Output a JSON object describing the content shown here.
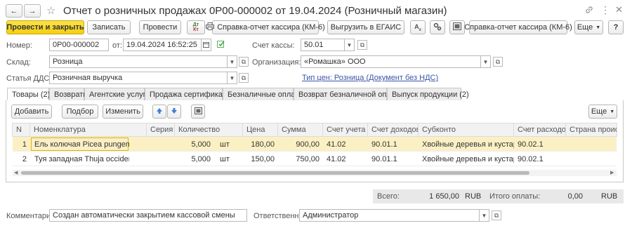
{
  "window": {
    "title": "Отчет о розничных продажах 0Р00-000002 от 19.04.2024 (Розничный магазин)",
    "back_glyph": "←",
    "forward_glyph": "→",
    "star_glyph": "☆",
    "link_glyph": "🔗",
    "menu_glyph": "⋮",
    "restore_glyph": "▭",
    "close_glyph": "✕"
  },
  "toolbar": {
    "post_close": "Провести и закрыть",
    "write": "Записать",
    "post": "Провести",
    "dt_kt": "Дт Кт",
    "cashier_report_1": "Справка-отчет кассира (КМ-6)",
    "egais": "Выгрузить в ЕГАИС",
    "cashier_report_2": "Справка-отчет кассира (КМ-6)",
    "more": "Еще",
    "help": "?"
  },
  "form": {
    "number_label": "Номер:",
    "number": "0Р00-000002",
    "date_label": "от:",
    "date": "19.04.2024 16:52:25",
    "account_label": "Счет кассы:",
    "account": "50.01",
    "warehouse_label": "Склад:",
    "warehouse": "Розница",
    "org_label": "Организация:",
    "org": "«Ромашка» ООО",
    "dds_label": "Статья ДДС:",
    "dds": "Розничная выручка",
    "price_type_link": "Тип цен: Розница (Документ без НДС)"
  },
  "tabs": [
    {
      "label": "Товары (2)"
    },
    {
      "label": "Возвраты"
    },
    {
      "label": "Агентские услуги"
    },
    {
      "label": "Продажа сертификатов"
    },
    {
      "label": "Безналичные оплаты"
    },
    {
      "label": "Возврат безналичной оплаты"
    },
    {
      "label": "Выпуск продукции (2)"
    }
  ],
  "table_toolbar": {
    "add": "Добавить",
    "pick": "Подбор",
    "edit": "Изменить",
    "more": "Еще"
  },
  "table": {
    "headers": {
      "n": "N",
      "item": "Номенклатура",
      "series": "Серия",
      "qty": "Количество",
      "price": "Цена",
      "sum": "Сумма",
      "account": "Счет учета",
      "income": "Счет доходов",
      "subconto": "Субконто",
      "expense": "Счет расходов",
      "country": "Страна происхо"
    },
    "rows": [
      {
        "n": "1",
        "item": "Ель колючая Picea pungens ...",
        "series": "",
        "qty": "5,000",
        "unit": "шт",
        "price": "180,00",
        "sum": "900,00",
        "account": "41.02",
        "income": "90.01.1",
        "subconto": "Хвойные деревья и кустар...",
        "expense": "90.02.1",
        "country": ""
      },
      {
        "n": "2",
        "item": "Туя западная Thuja occident...",
        "series": "",
        "qty": "5,000",
        "unit": "шт",
        "price": "150,00",
        "sum": "750,00",
        "account": "41.02",
        "income": "90.01.1",
        "subconto": "Хвойные деревья и кустар...",
        "expense": "90.02.1",
        "country": ""
      }
    ]
  },
  "totals": {
    "total_label": "Всего:",
    "total_value": "1 650,00",
    "total_currency": "RUB",
    "paid_label": "Итого оплаты:",
    "paid_value": "0,00",
    "paid_currency": "RUB"
  },
  "footer": {
    "comment_label": "Комментарий:",
    "comment": "Создан автоматически закрытием кассовой смены",
    "responsible_label": "Ответственный:",
    "responsible": "Администратор"
  },
  "colors": {
    "accent_yellow": "#f5cf11",
    "selected_row": "#fbf0c4",
    "link": "#3a55a8"
  }
}
